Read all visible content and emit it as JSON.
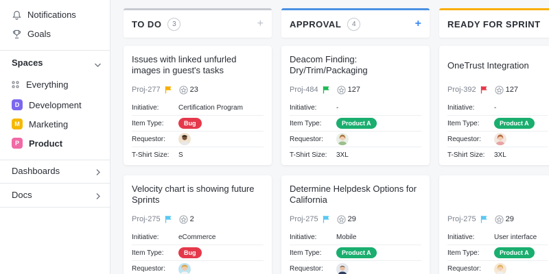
{
  "sidebar": {
    "top_items": [
      {
        "label": "Notifications",
        "icon": "bell-icon"
      },
      {
        "label": "Goals",
        "icon": "trophy-icon"
      }
    ],
    "spaces_title": "Spaces",
    "spaces": [
      {
        "label": "Everything",
        "icon": "grid-icon"
      },
      {
        "label": "Development",
        "badge": "D",
        "color": "#7b68ee"
      },
      {
        "label": "Marketing",
        "badge": "M",
        "color": "#f5b800"
      },
      {
        "label": "Product",
        "badge": "P",
        "color": "#f16aa5"
      }
    ],
    "bottom_items": [
      {
        "label": "Dashboards"
      },
      {
        "label": "Docs"
      }
    ]
  },
  "columns": [
    {
      "title": "TO DO",
      "count": "3",
      "accent": "#c7cad0",
      "add_color": "#b9bec7",
      "cards": [
        {
          "title": "Issues with linked unfurled images in guest's tasks",
          "id": "Proj-277",
          "flag_color": "#f8ae00",
          "points": "23",
          "fields": {
            "initiative": "Certification Program",
            "item_type": "Bug",
            "item_type_color": "#e5394b",
            "tshirt": "S"
          }
        },
        {
          "title": "Velocity chart is showing future Sprints",
          "id": "Proj-275",
          "flag_color": "#5ac8f2",
          "points": "2",
          "fields": {
            "initiative": "eCommerce",
            "item_type": "Bug",
            "item_type_color": "#e5394b"
          }
        }
      ]
    },
    {
      "title": "APPROVAL",
      "count": "4",
      "accent": "#4a90e2",
      "add_color": "#3d8af7",
      "cards": [
        {
          "title": "Deacom Finding: Dry/Trim/Packaging",
          "id": "Proj-484",
          "flag_color": "#1db954",
          "points": "127",
          "fields": {
            "initiative": "-",
            "item_type": "Product A",
            "item_type_color": "#1aae6f",
            "tshirt": "3XL"
          }
        },
        {
          "title": "Determine Helpdesk Options for California",
          "id": "Proj-275",
          "flag_color": "#5ac8f2",
          "points": "29",
          "fields": {
            "initiative": "Mobile",
            "item_type": "Product A",
            "item_type_color": "#1aae6f"
          }
        }
      ]
    },
    {
      "title": "READY FOR SPRINT",
      "accent": "#f8ae00",
      "cards": [
        {
          "title": "OneTrust Integration",
          "id": "Proj-392",
          "flag_color": "#e5394b",
          "points": "127",
          "fields": {
            "initiative": "-",
            "item_type": "Product A",
            "item_type_color": "#1aae6f",
            "tshirt": "3XL"
          }
        },
        {
          "title": "",
          "id": "Proj-275",
          "flag_color": "#5ac8f2",
          "points": "29",
          "fields": {
            "initiative": "User interface",
            "item_type": "Product A",
            "item_type_color": "#1aae6f"
          }
        }
      ]
    }
  ],
  "labels": {
    "initiative": "Initiative:",
    "item_type": "Item Type:",
    "requestor": "Requestor:",
    "tshirt": "T-Shirt Size:"
  }
}
